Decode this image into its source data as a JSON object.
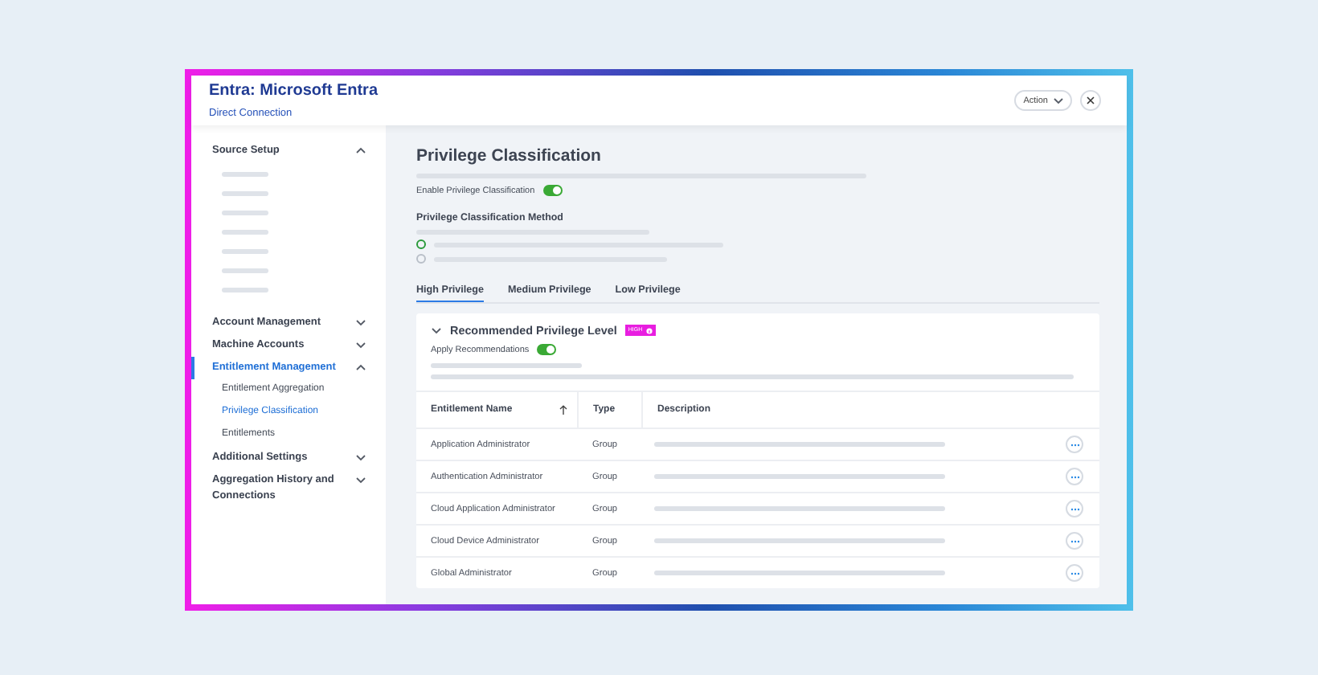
{
  "header": {
    "title": "Entra: Microsoft Entra",
    "subtitle": "Direct Connection",
    "action_button": "Action"
  },
  "sidebar": {
    "items": [
      {
        "label": "Source Setup",
        "expanded": true,
        "selected": false
      },
      {
        "label": "Account Management",
        "expanded": false,
        "selected": false
      },
      {
        "label": "Machine Accounts",
        "expanded": false,
        "selected": false
      },
      {
        "label": "Entitlement Management",
        "expanded": true,
        "selected": true,
        "children": [
          {
            "label": "Entitlement Aggregation",
            "selected": false
          },
          {
            "label": "Privilege Classification",
            "selected": true
          },
          {
            "label": "Entitlements",
            "selected": false
          }
        ]
      },
      {
        "label": "Additional Settings",
        "expanded": false,
        "selected": false
      },
      {
        "label": "Aggregation History and Connections",
        "expanded": false,
        "selected": false
      }
    ]
  },
  "main": {
    "title": "Privilege Classification",
    "enable_toggle": {
      "label": "Enable Privilege Classification",
      "on": true
    },
    "method": {
      "label": "Privilege Classification Method",
      "options": [
        {
          "selected": true
        },
        {
          "selected": false
        }
      ]
    },
    "tabs": [
      {
        "label": "High Privilege",
        "selected": true
      },
      {
        "label": "Medium Privilege",
        "selected": false
      },
      {
        "label": "Low Privilege",
        "selected": false
      }
    ],
    "card": {
      "title": "Recommended Privilege Level",
      "expanded": true,
      "badge": "HIGH",
      "apply_toggle": {
        "label": "Apply Recommendations",
        "on": true
      },
      "table": {
        "columns": [
          "Entitlement Name",
          "Type",
          "Description"
        ],
        "rows": [
          {
            "name": "Application Administrator",
            "type": "Group"
          },
          {
            "name": "Authentication Administrator",
            "type": "Group"
          },
          {
            "name": "Cloud Application Administrator",
            "type": "Group"
          },
          {
            "name": "Cloud Device Administrator",
            "type": "Group"
          },
          {
            "name": "Global Administrator",
            "type": "Group"
          }
        ]
      }
    }
  }
}
